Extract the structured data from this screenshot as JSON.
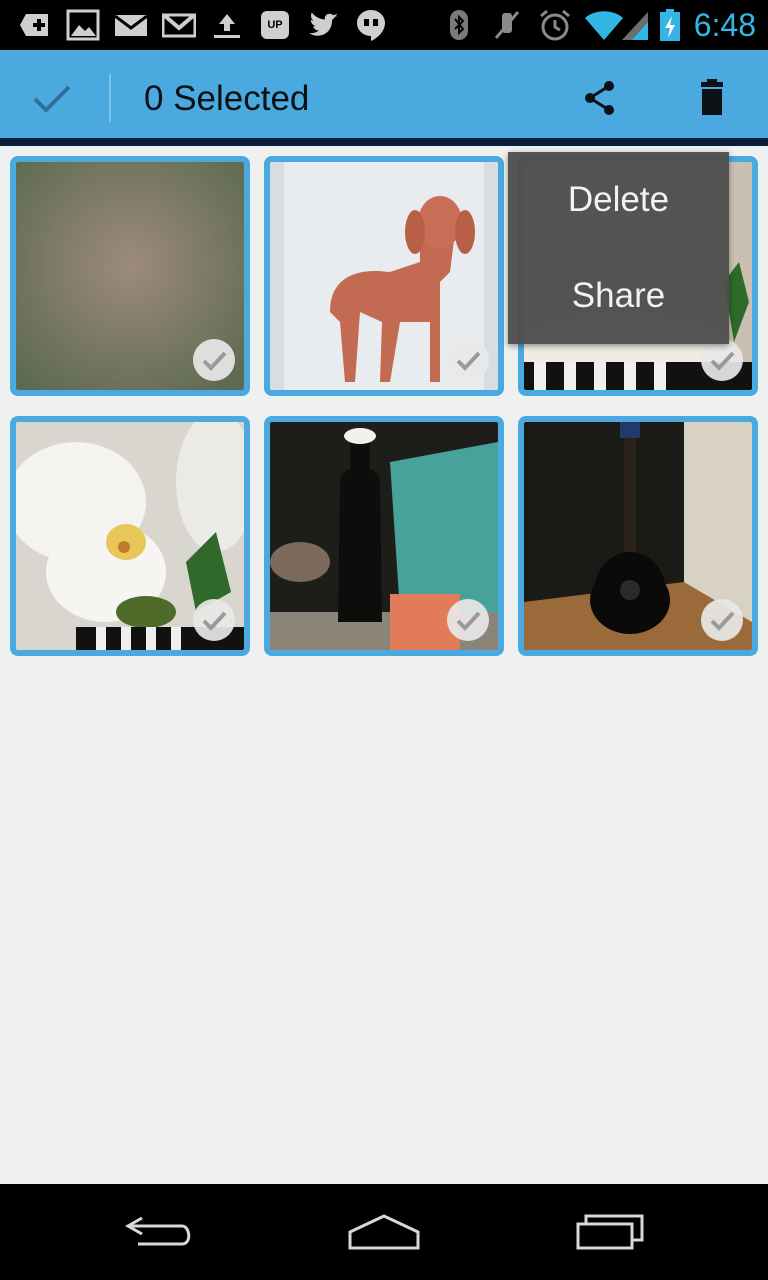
{
  "status_bar": {
    "time": "6:48",
    "icons": [
      "add-notification-icon",
      "gallery-icon",
      "email-icon",
      "gmail-icon",
      "upload-icon",
      "voicemail-icon",
      "twitter-icon",
      "hangouts-icon",
      "bluetooth-icon",
      "muted-icon",
      "alarm-icon",
      "wifi-icon",
      "signal-icon",
      "battery-charging-icon"
    ],
    "accent": "#33b5e5"
  },
  "action_bar": {
    "title": "0 Selected",
    "icons": [
      "done-check-icon",
      "share-icon",
      "trash-icon"
    ],
    "color": "#4aa9df"
  },
  "popup_menu": {
    "items": [
      "Delete",
      "Share"
    ]
  },
  "grid": {
    "photos": [
      {
        "subject": "green wall blur",
        "selected": true
      },
      {
        "subject": "dachshund drawing",
        "selected": true
      },
      {
        "subject": "plant on striped cloth",
        "selected": true
      },
      {
        "subject": "white orchid",
        "selected": true
      },
      {
        "subject": "dark bottle on windowsill",
        "selected": true
      },
      {
        "subject": "acoustic guitar",
        "selected": true
      }
    ],
    "selection_color": "#4aa9df"
  },
  "nav_bar": {
    "buttons": [
      "back-icon",
      "home-icon",
      "recents-icon"
    ]
  }
}
